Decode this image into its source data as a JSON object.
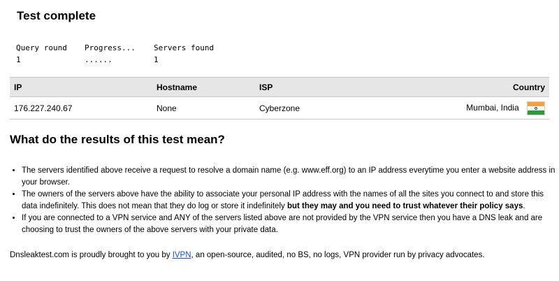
{
  "title": "Test complete",
  "stats": {
    "query_round_label": "Query round",
    "query_round_value": "1",
    "progress_label": "Progress...",
    "progress_value": "......",
    "servers_found_label": "Servers found",
    "servers_found_value": "1"
  },
  "table": {
    "headers": {
      "ip": "IP",
      "hostname": "Hostname",
      "isp": "ISP",
      "country": "Country"
    },
    "rows": [
      {
        "ip": "176.227.240.67",
        "hostname": "None",
        "isp": "Cyberzone",
        "country": "Mumbai, India",
        "flag_icon": "india-flag-icon"
      }
    ]
  },
  "meaning": {
    "heading": "What do the results of this test mean?",
    "bullets": [
      {
        "text": "The servers identified above receive a request to resolve a domain name (e.g. www.eff.org) to an IP address everytime you enter a website address in your browser."
      },
      {
        "text": "The owners of the servers above have the ability to associate your personal IP address with the names of all the sites you connect to and store this data indefinitely. This does not mean that they do log or store it indefinitely ",
        "bold": "but they may and you need to trust whatever their policy says",
        "tail": "."
      },
      {
        "text": "If you are connected to a VPN service and ANY of the servers listed above are not provided by the VPN service then you have a DNS leak and are choosing to trust the owners of the above servers with your private data."
      }
    ]
  },
  "footer": {
    "prefix": "Dnsleaktest.com is proudly brought to you by ",
    "link": "IVPN",
    "suffix": ", an open-source, audited, no BS, no logs, VPN provider run by privacy advocates."
  },
  "colors": {
    "header_bg": "#e6e6e6",
    "link": "#1a4fc4",
    "flag_saffron": "#f4a23a",
    "flag_green": "#2e9a3a"
  }
}
